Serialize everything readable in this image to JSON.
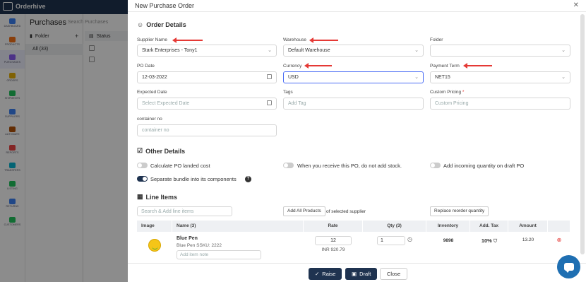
{
  "app": {
    "name": "Orderhive",
    "nav": [
      {
        "label": "DASHBOARD",
        "color": "#3b82f6"
      },
      {
        "label": "PRODUCTS",
        "color": "#f97316"
      },
      {
        "label": "PURCHASES",
        "color": "#8b5cf6"
      },
      {
        "label": "ORDERS",
        "color": "#eab308"
      },
      {
        "label": "SHIPMENTS",
        "color": "#22c55e"
      },
      {
        "label": "SUPPLIERS",
        "color": "#3b82f6"
      },
      {
        "label": "AUTOMATE",
        "color": "#b45309"
      },
      {
        "label": "REPORTS",
        "color": "#ef4444"
      },
      {
        "label": "TRANSFERS",
        "color": "#06b6d4"
      },
      {
        "label": "LISTING",
        "color": "#22c55e"
      },
      {
        "label": "RETURNS",
        "color": "#3b82f6"
      },
      {
        "label": "CUSTOMERS",
        "color": "#22c55e"
      }
    ]
  },
  "purchases": {
    "title": "Purchases",
    "search_placeholder": "Search Purchases",
    "folder_label": "Folder",
    "all_label": "All (33)",
    "status_label": "Status"
  },
  "modal": {
    "title": "New Purchase Order",
    "order_details": "Order Details",
    "supplier_label": "Supplier Name",
    "supplier_value": "Stark Enterprises - Tony1",
    "warehouse_label": "Warehouse",
    "warehouse_value": "Default Warehouse",
    "folder_label": "Folder",
    "po_date_label": "PO Date",
    "po_date_value": "12-03-2022",
    "currency_label": "Currency",
    "currency_value": "USD",
    "payment_term_label": "Payment Term",
    "payment_term_value": "NET15",
    "expected_date_label": "Expected Date",
    "expected_date_placeholder": "Select Expected Date",
    "tags_label": "Tags",
    "tags_placeholder": "Add Tag",
    "custom_pricing_label": "Custom Pricing",
    "custom_pricing_placeholder": "Custom Pricing",
    "container_label": "container no",
    "container_placeholder": "container no",
    "other_details": "Other Details",
    "opt_landed": "Calculate PO landed cost",
    "opt_no_stock": "When you receive this PO, do not add stock.",
    "opt_incoming": "Add incoming quantity on draft PO",
    "opt_bundle": "Separate bundle into its components",
    "line_items": "Line Items",
    "line_search_placeholder": "Search & Add line items",
    "add_all_products": "Add All Products",
    "of_selected_supplier": "of selected supplier",
    "replace_reorder": "Replace reorder quantity",
    "table_headers": [
      "Image",
      "Name (3)",
      "Rate",
      "Qty (3)",
      "Inventory",
      "Add. Tax",
      "Amount"
    ],
    "item": {
      "name": "Blue Pen",
      "sub": "Blue Pen  SSKU: 2222",
      "note_placeholder": "Add item note",
      "rate": "12",
      "rate_inr": "INR 920.79",
      "qty": "1",
      "inventory": "9898",
      "tax": "10%",
      "amount": "13.20"
    },
    "raise": "Raise",
    "draft": "Draft",
    "close": "Close"
  },
  "colors": {
    "brand": "#1f3350",
    "annotation": "#e53935"
  }
}
